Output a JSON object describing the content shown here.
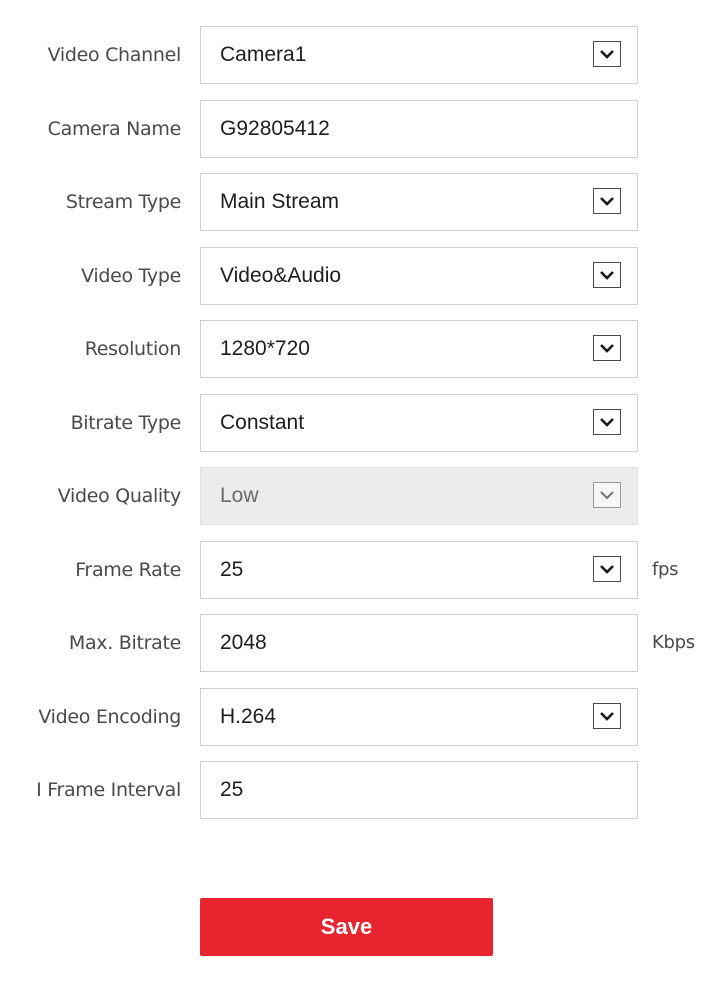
{
  "form": {
    "video_channel": {
      "label": "Video Channel",
      "value": "Camera1"
    },
    "camera_name": {
      "label": "Camera Name",
      "value": "G92805412"
    },
    "stream_type": {
      "label": "Stream Type",
      "value": "Main Stream"
    },
    "video_type": {
      "label": "Video Type",
      "value": "Video&Audio"
    },
    "resolution": {
      "label": "Resolution",
      "value": "1280*720"
    },
    "bitrate_type": {
      "label": "Bitrate Type",
      "value": "Constant"
    },
    "video_quality": {
      "label": "Video Quality",
      "value": "Low",
      "disabled": true
    },
    "frame_rate": {
      "label": "Frame Rate",
      "value": "25",
      "unit": "fps"
    },
    "max_bitrate": {
      "label": "Max. Bitrate",
      "value": "2048",
      "unit": "Kbps"
    },
    "video_encoding": {
      "label": "Video Encoding",
      "value": "H.264"
    },
    "i_frame_interval": {
      "label": "I Frame Interval",
      "value": "25"
    }
  },
  "actions": {
    "save_label": "Save"
  },
  "icons": {
    "dropdown": "chevron-down-icon"
  },
  "colors": {
    "save_button": "#e8242f",
    "disabled_field": "#ececec"
  }
}
